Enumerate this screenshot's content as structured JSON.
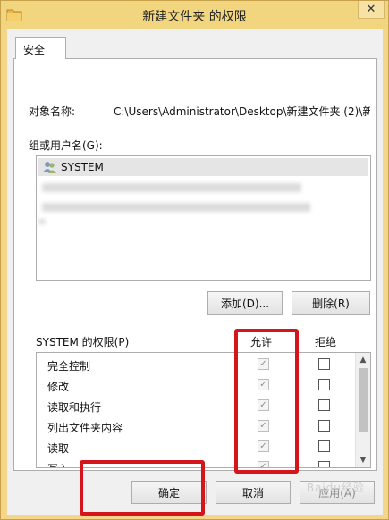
{
  "window": {
    "title": "新建文件夹 的权限",
    "close_glyph": "✕"
  },
  "tabs": [
    {
      "label": "安全"
    }
  ],
  "object": {
    "label": "对象名称:",
    "path": "C:\\Users\\Administrator\\Desktop\\新建文件夹 (2)\\新"
  },
  "groups": {
    "label": "组或用户名(G):",
    "items": [
      {
        "name": "SYSTEM",
        "icon": "users-icon"
      }
    ]
  },
  "buttons": {
    "add": "添加(D)...",
    "remove": "删除(R)",
    "ok": "确定",
    "cancel": "取消",
    "apply": "应用(A)"
  },
  "permissions": {
    "title": "SYSTEM 的权限(P)",
    "allow_header": "允许",
    "deny_header": "拒绝",
    "rows": [
      {
        "name": "完全控制",
        "allow": "✓"
      },
      {
        "name": "修改",
        "allow": "✓"
      },
      {
        "name": "读取和执行",
        "allow": "✓"
      },
      {
        "name": "列出文件夹内容",
        "allow": "✓"
      },
      {
        "name": "读取",
        "allow": "✓"
      },
      {
        "name": "写入",
        "allow": "✓"
      }
    ]
  },
  "watermark": "Baidu经验",
  "colors": {
    "highlight_red": "#d4151b",
    "title_bar": "#f2d57f"
  }
}
